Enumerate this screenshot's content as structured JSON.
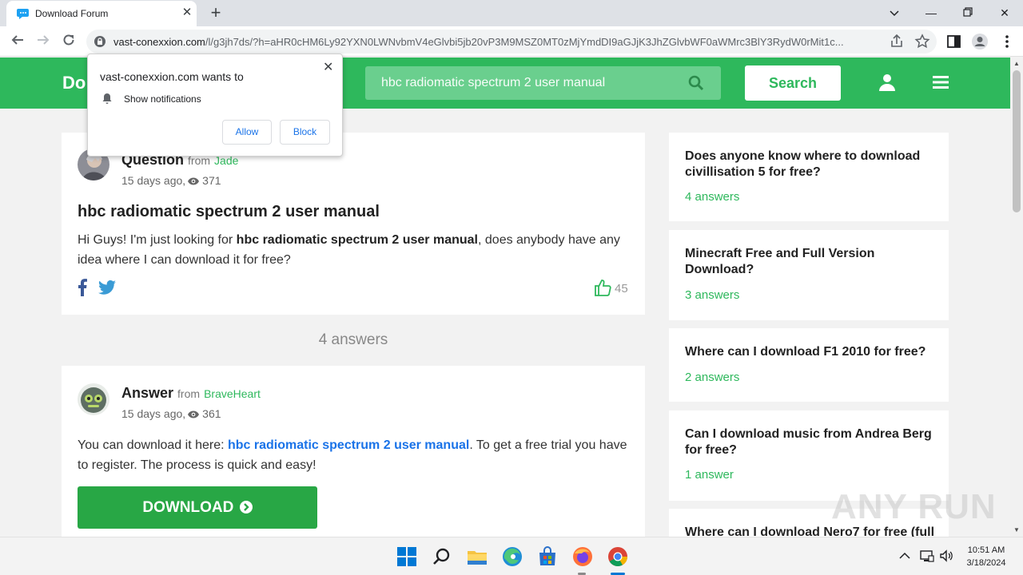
{
  "browser": {
    "tab_title": "Download Forum",
    "url_host": "vast-conexxion.com",
    "url_path": "/l/g3jh7ds/?h=aHR0cHM6Ly92YXN0LWNvbmV4eGlvbi5jb20vP3M9MSZ0MT0zMjYmdDI9aGJjK3JhZGlvbWF0aWMrc3BlY3RydW0rMit1c..."
  },
  "notification": {
    "title": "vast-conexxion.com wants to",
    "permission": "Show notifications",
    "allow_label": "Allow",
    "block_label": "Block"
  },
  "header": {
    "brand": "Do",
    "search_value": "hbc radiomatic spectrum 2 user manual",
    "search_button": "Search"
  },
  "question": {
    "label": "Question",
    "from": "from",
    "author": "Jade",
    "age": "15 days ago,",
    "views": "371",
    "title": "hbc radiomatic spectrum 2 user manual",
    "body_prefix": "Hi Guys! I'm just looking for ",
    "body_bold": "hbc radiomatic spectrum 2 user manual",
    "body_suffix": ", does anybody have any idea where I can download it for free?",
    "likes": "45"
  },
  "answers_count": "4 answers",
  "answer": {
    "label": "Answer",
    "from": "from",
    "author": "BraveHeart",
    "age": "15 days ago,",
    "views": "361",
    "body_prefix": "You can download it here: ",
    "link_text": "hbc radiomatic spectrum 2 user manual",
    "body_suffix": ". To get a free trial you have to register. The process is quick and easy!",
    "download_label": "DOWNLOAD"
  },
  "sidebar": [
    {
      "question": "Does anyone know where to download civillisation 5 for free?",
      "answers": "4 answers"
    },
    {
      "question": "Minecraft Free and Full Version Download?",
      "answers": "3 answers"
    },
    {
      "question": "Where can I download F1 2010 for free?",
      "answers": "2 answers"
    },
    {
      "question": "Can I download music from Andrea Berg for free?",
      "answers": "1 answer"
    },
    {
      "question": "Where can I download Nero7 for free (full",
      "answers": ""
    }
  ],
  "taskbar": {
    "time": "10:51 AM",
    "date": "3/18/2024"
  },
  "watermark": "ANY RUN",
  "colors": {
    "brand_green": "#2eb85c",
    "download_green": "#28a745",
    "link_blue": "#1a73e8"
  }
}
